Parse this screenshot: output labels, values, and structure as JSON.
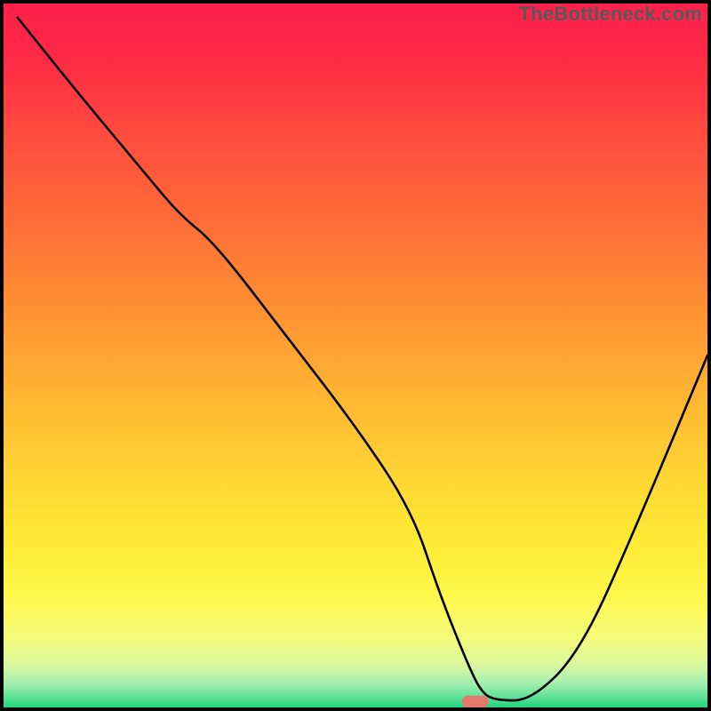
{
  "watermark": "TheBottleneck.com",
  "chart_data": {
    "type": "line",
    "title": "",
    "xlabel": "",
    "ylabel": "",
    "xlim": [
      0,
      100
    ],
    "ylim": [
      0,
      100
    ],
    "grid": false,
    "legend": false,
    "series": [
      {
        "name": "curve",
        "x": [
          2,
          10,
          20,
          25,
          30,
          40,
          50,
          58,
          62,
          66,
          68,
          70,
          75,
          82,
          90,
          100
        ],
        "y": [
          98,
          88,
          76,
          70,
          66,
          53,
          40,
          28,
          16,
          6,
          2,
          1,
          1,
          8,
          26,
          50
        ]
      }
    ],
    "marker": {
      "name": "min-marker",
      "x": 67,
      "y": 0.8,
      "color": "#e5786d"
    },
    "gradient_stops": [
      {
        "offset": 0.0,
        "color": "#ff1f4b"
      },
      {
        "offset": 0.08,
        "color": "#ff2a45"
      },
      {
        "offset": 0.18,
        "color": "#ff4a3f"
      },
      {
        "offset": 0.3,
        "color": "#ff6a38"
      },
      {
        "offset": 0.42,
        "color": "#ff8c33"
      },
      {
        "offset": 0.54,
        "color": "#ffb032"
      },
      {
        "offset": 0.66,
        "color": "#ffd233"
      },
      {
        "offset": 0.76,
        "color": "#ffe934"
      },
      {
        "offset": 0.84,
        "color": "#fef84a"
      },
      {
        "offset": 0.9,
        "color": "#f6fb7a"
      },
      {
        "offset": 0.94,
        "color": "#d9f79e"
      },
      {
        "offset": 0.965,
        "color": "#a8efb0"
      },
      {
        "offset": 0.985,
        "color": "#5fe297"
      },
      {
        "offset": 1.0,
        "color": "#1fd47f"
      }
    ]
  }
}
